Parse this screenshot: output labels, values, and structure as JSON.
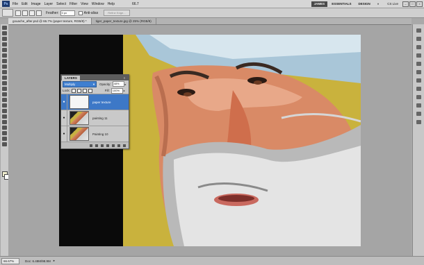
{
  "menubar": {
    "app_logo": "Ps",
    "items": [
      "File",
      "Edit",
      "Image",
      "Layer",
      "Select",
      "Filter",
      "View",
      "Window",
      "Help"
    ],
    "zoom": "66.7",
    "workspaces": [
      "JAMES",
      "ESSENTIALS",
      "DESIGN"
    ],
    "cs_live": "CS Live",
    "more": "»"
  },
  "options": {
    "feather_label": "Feather:",
    "feather_value": "0 px",
    "antialias_label": "Anti-alias",
    "refine_edge": "Refine Edge..."
  },
  "tabs": [
    {
      "label": "gouache_after.psd @ 66.7% (paper texture, RGB/8) *",
      "active": true
    },
    {
      "label": "tiger_paper_texture.jpg @ 25% (RGB/8)",
      "active": false
    }
  ],
  "layers_panel": {
    "tab_label": "LAYERS",
    "blend_mode": "Multiply",
    "opacity_label": "Opacity:",
    "opacity_value": "48%",
    "lock_label": "Lock:",
    "fill_label": "Fill:",
    "fill_value": "100%",
    "layers": [
      {
        "name": "paper texture",
        "selected": true,
        "thumb": "paper"
      },
      {
        "name": "painting 11",
        "selected": false,
        "thumb": "face"
      },
      {
        "name": "Painting 10",
        "selected": false,
        "thumb": "face"
      }
    ]
  },
  "status": {
    "zoom": "66.67%",
    "doc": "Doc: 6.48M/98.9M"
  },
  "colors": {
    "accent": "#3d78c7",
    "panel": "#c9c9c9",
    "workspace_bg": "#a5a5a5"
  }
}
